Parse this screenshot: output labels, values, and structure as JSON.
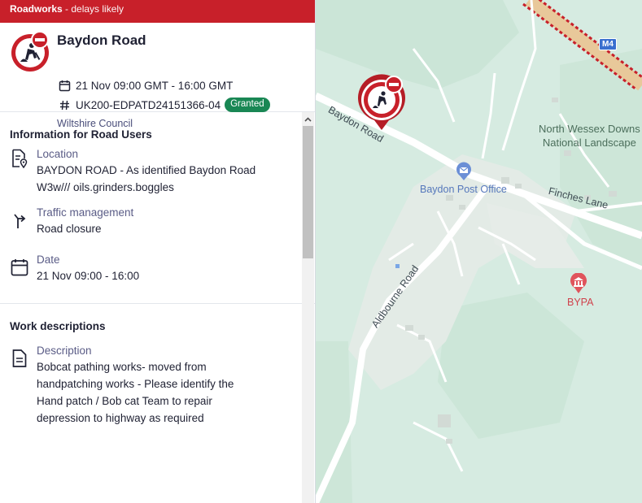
{
  "banner": {
    "title": "Roadworks",
    "subtitle": "- delays likely"
  },
  "header": {
    "title": "Baydon Road",
    "date_range": "21 Nov 09:00 GMT - 16:00 GMT",
    "reference": "UK200-EDPATD24151366-04",
    "status": "Granted",
    "authority": "Wiltshire Council"
  },
  "road_users": {
    "heading": "Information for Road Users",
    "location_label": "Location",
    "location_value_line1": "BAYDON ROAD - As identified Baydon Road",
    "location_value_line2": "W3w/// oils.grinders.boggles",
    "traffic_label": "Traffic management",
    "traffic_value": "Road closure",
    "date_label": "Date",
    "date_value": "21 Nov 09:00 - 16:00"
  },
  "work": {
    "heading": "Work descriptions",
    "description_label": "Description",
    "description_lines": [
      "Bobcat pathing works- moved from",
      "handpatching works - Please identify the",
      "Hand patch / Bob cat Team to repair",
      "depression to highway as required"
    ]
  },
  "map": {
    "labels": {
      "baydon_road": "Baydon Road",
      "post_office": "Baydon Post Office",
      "finches_lane": "Finches Lane",
      "aldbourne_road": "Aldbourne Road",
      "landscape_line1": "North Wessex Downs",
      "landscape_line2": "National Landscape",
      "bypa": "BYPA",
      "motorway": "M4"
    }
  },
  "colors": {
    "banner": "#c8202a",
    "badge": "#198754",
    "map_green": "#d6ebe1",
    "urban": "#e6ece8"
  },
  "icons": [
    "roadworks-sign-icon",
    "calendar-icon",
    "hash-icon",
    "location-document-icon",
    "turn-arrow-icon",
    "calendar-icon",
    "document-icon",
    "scroll-up-icon",
    "map-pin-icon",
    "post-office-icon",
    "museum-icon"
  ]
}
